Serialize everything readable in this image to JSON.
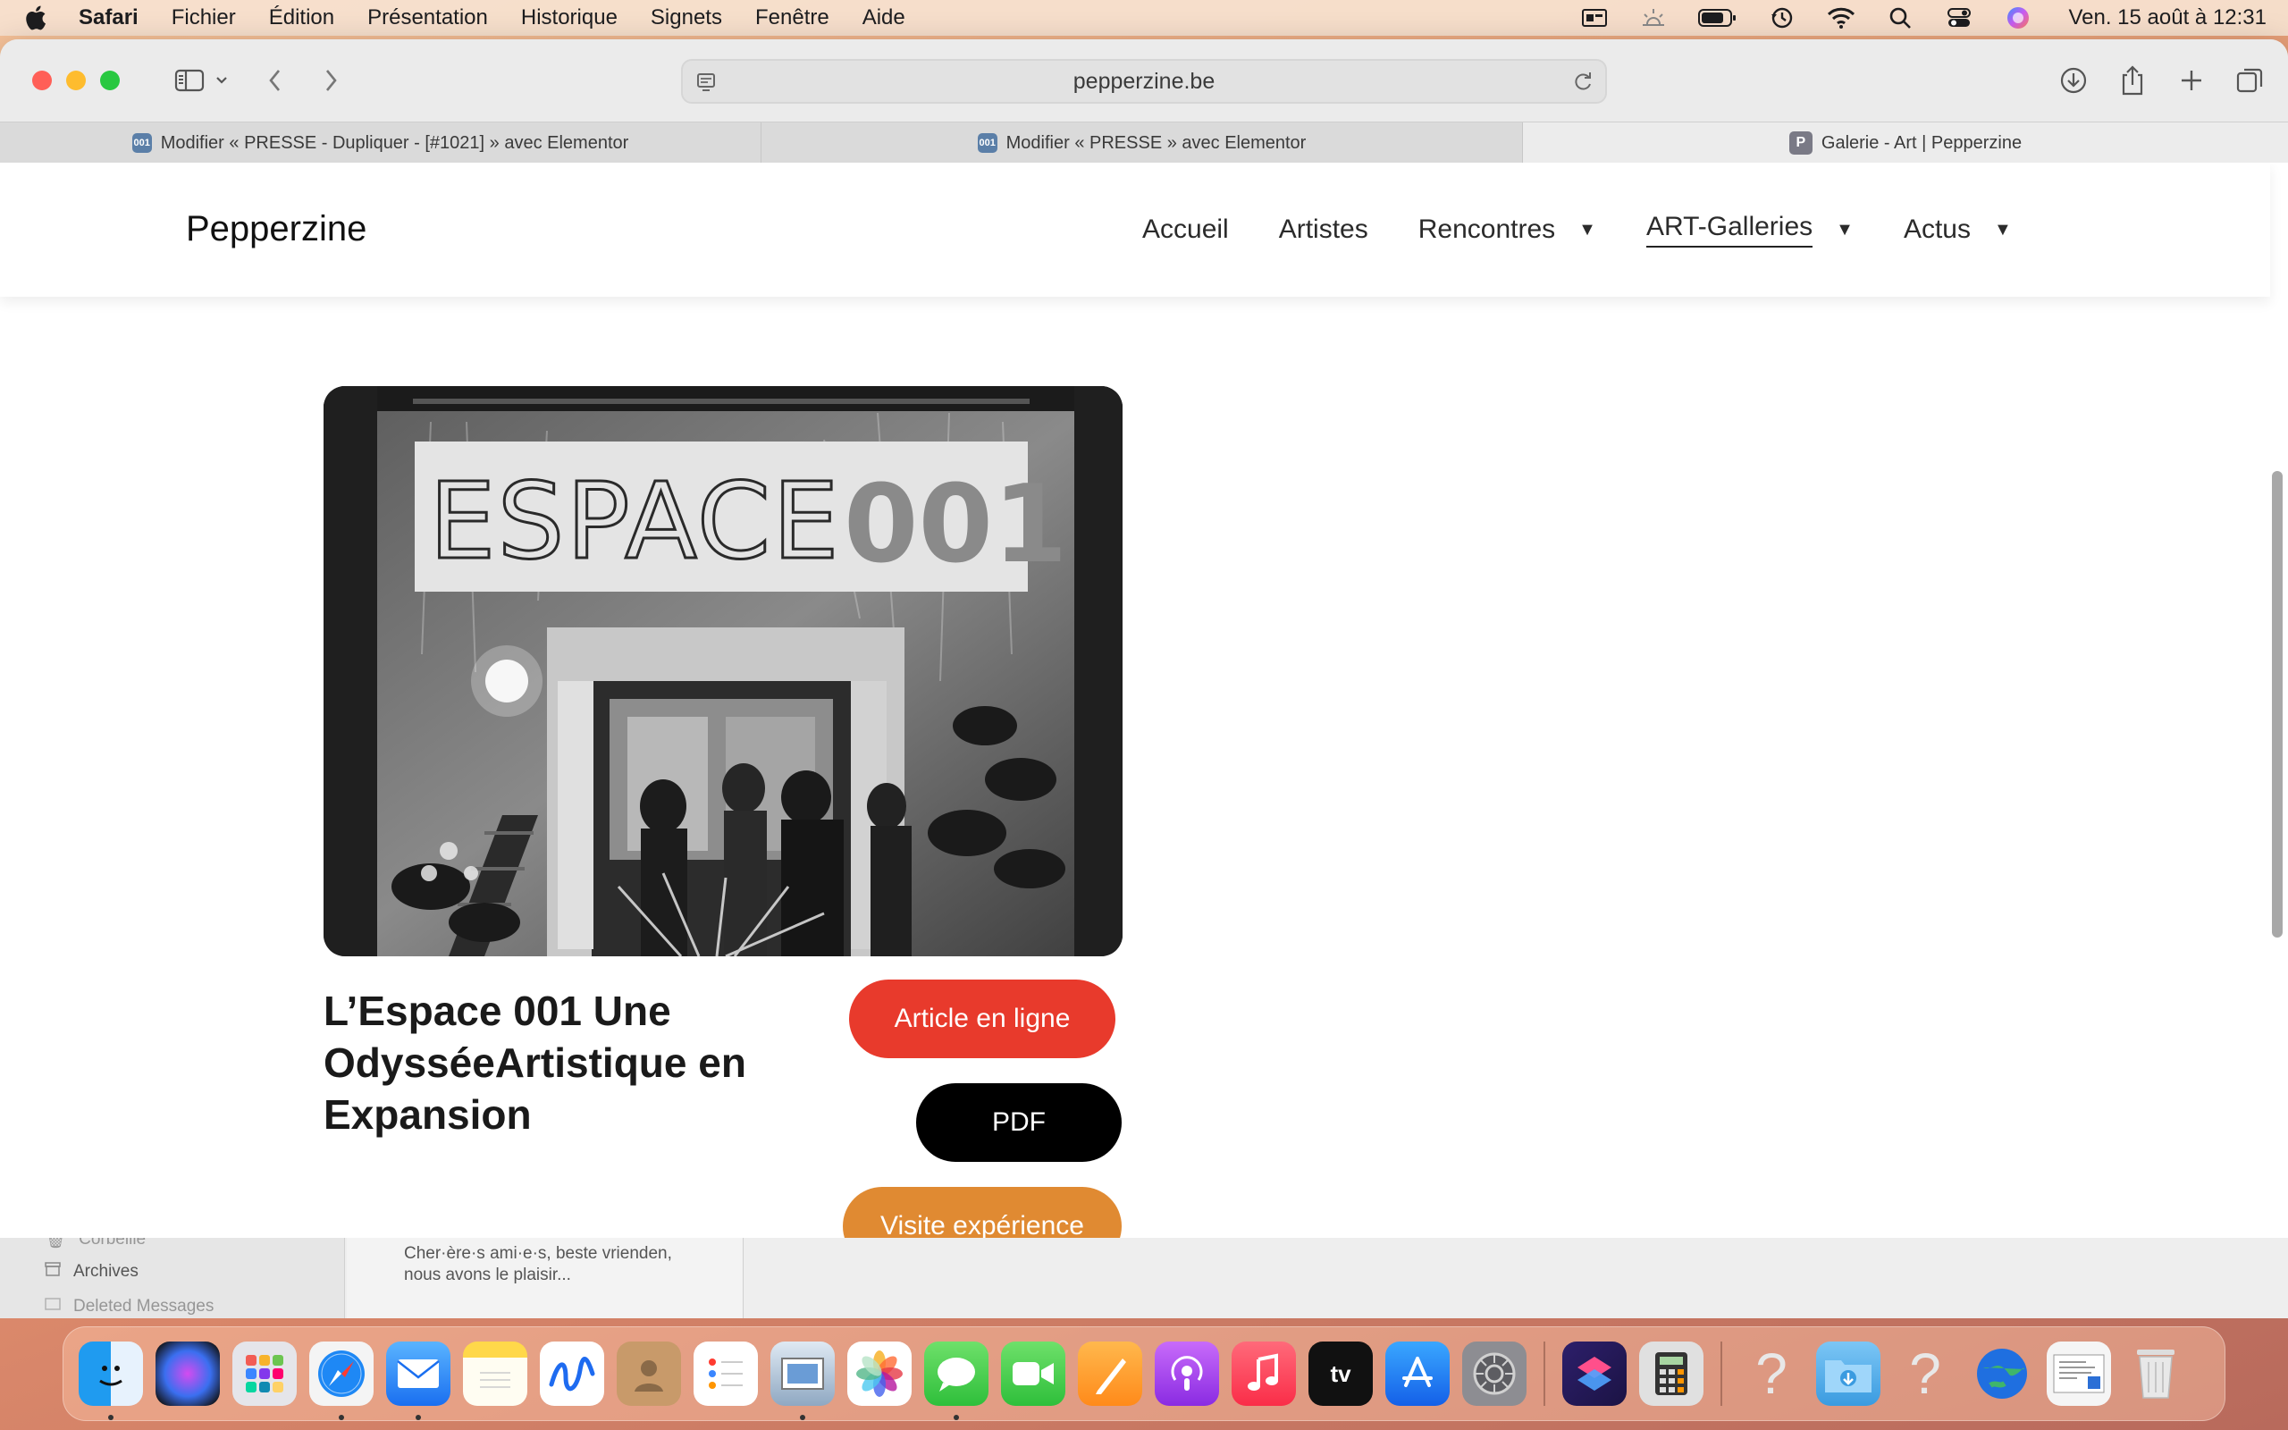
{
  "menubar": {
    "app_name": "Safari",
    "items": [
      "Fichier",
      "Édition",
      "Présentation",
      "Historique",
      "Signets",
      "Fenêtre",
      "Aide"
    ],
    "clock": "Ven. 15 août à 12:31",
    "status_icons": [
      "screen-mirroring-icon",
      "weather-icon",
      "battery-icon",
      "time-machine-icon",
      "wifi-icon",
      "spotlight-search-icon",
      "control-center-icon",
      "siri-icon"
    ]
  },
  "safari": {
    "url": "pepperzine.be",
    "tabs": [
      {
        "favicon": "001",
        "title": "Modifier « PRESSE - Dupliquer - [#1021] » avec Elementor"
      },
      {
        "favicon": "001",
        "title": "Modifier « PRESSE » avec Elementor"
      },
      {
        "favicon": "P",
        "title": "Galerie - Art | Pepperzine"
      }
    ]
  },
  "site": {
    "logo": "Pepperzine",
    "nav": [
      {
        "label": "Accueil",
        "has_dropdown": false,
        "current": false
      },
      {
        "label": "Artistes",
        "has_dropdown": false,
        "current": false
      },
      {
        "label": "Rencontres",
        "has_dropdown": true,
        "current": false
      },
      {
        "label": "ART-Galleries",
        "has_dropdown": true,
        "current": true
      },
      {
        "label": "Actus",
        "has_dropdown": true,
        "current": false
      }
    ],
    "caret": "▼",
    "article": {
      "image_sign_text": "ESPACE 001",
      "title": "L’Espace 001 Une OdysséeArtistique en Expansion",
      "buttons": {
        "article": "Article en ligne",
        "pdf": "PDF",
        "visite": "Visite expérience"
      },
      "colors": {
        "article": "#e83a2c",
        "pdf": "#000000",
        "visite": "#e08a32"
      }
    }
  },
  "mail_peek": {
    "folders": [
      "Corbeille",
      "Archives",
      "Deleted Messages"
    ],
    "snippet": "Cher·ère·s ami·e·s, beste vrienden, nous avons le plaisir..."
  },
  "dock": {
    "apps": [
      {
        "name": "finder",
        "running": true
      },
      {
        "name": "siri",
        "running": false
      },
      {
        "name": "launchpad",
        "running": false
      },
      {
        "name": "safari",
        "running": true
      },
      {
        "name": "mail",
        "running": true
      },
      {
        "name": "notes",
        "running": false
      },
      {
        "name": "freeform",
        "running": false
      },
      {
        "name": "contacts",
        "running": false
      },
      {
        "name": "reminders",
        "running": false
      },
      {
        "name": "preview",
        "running": true
      },
      {
        "name": "photos",
        "running": false
      },
      {
        "name": "messages",
        "running": true
      },
      {
        "name": "facetime",
        "running": false
      },
      {
        "name": "pages",
        "running": false
      },
      {
        "name": "podcasts",
        "running": false
      },
      {
        "name": "music",
        "running": false
      },
      {
        "name": "apple-tv",
        "running": false
      },
      {
        "name": "app-store",
        "running": false
      },
      {
        "name": "system-settings",
        "running": false
      },
      {
        "name": "shortcuts",
        "running": false
      },
      {
        "name": "calculator",
        "running": false
      },
      {
        "name": "unknown-app",
        "running": false
      },
      {
        "name": "downloads-folder",
        "running": false
      },
      {
        "name": "unknown-app",
        "running": false
      },
      {
        "name": "network-globe",
        "running": false
      },
      {
        "name": "document-preview",
        "running": false
      },
      {
        "name": "trash",
        "running": false
      }
    ],
    "tv_label": "tv"
  }
}
